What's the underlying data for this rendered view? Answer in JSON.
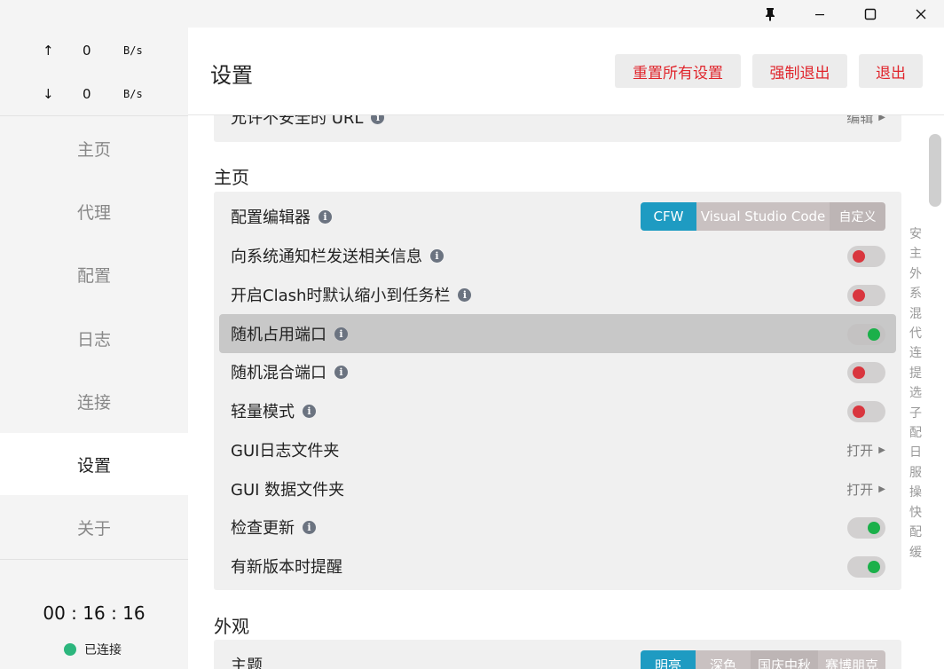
{
  "window": {
    "pin_icon": "pin-icon",
    "min_icon": "minimize-icon",
    "max_icon": "maximize-icon",
    "close_icon": "close-icon"
  },
  "traffic": {
    "up_arrow": "↑",
    "up_value": "0",
    "up_unit": "B/s",
    "down_arrow": "↓",
    "down_value": "0",
    "down_unit": "B/s"
  },
  "nav": {
    "home": "主页",
    "proxy": "代理",
    "profiles": "配置",
    "logs": "日志",
    "connections": "连接",
    "settings": "设置",
    "about": "关于"
  },
  "status": {
    "timer": "00 : 16 : 16",
    "connection": "已连接",
    "connection_color": "#2cb67d"
  },
  "header": {
    "title": "设置",
    "reset_all": "重置所有设置",
    "force_quit": "强制退出",
    "quit": "退出",
    "button_text_color": "#e0252c"
  },
  "prev_section": {
    "row_label": "允许不安全的 URL",
    "row_action": "编辑"
  },
  "home_section": {
    "title": "主页",
    "editor_label": "配置编辑器",
    "editor_options": [
      "CFW",
      "Visual Studio Code",
      "自定义"
    ],
    "editor_selected": "CFW",
    "notify_label": "向系统通知栏发送相关信息",
    "notify_on": false,
    "minimize_label": "开启Clash时默认缩小到任务栏",
    "minimize_on": false,
    "random_port_label": "随机占用端口",
    "random_port_on": true,
    "random_mixed_label": "随机混合端口",
    "random_mixed_on": false,
    "lite_label": "轻量模式",
    "lite_on": false,
    "gui_log_label": "GUI日志文件夹",
    "gui_log_action": "打开",
    "gui_data_label": "GUI 数据文件夹",
    "gui_data_action": "打开",
    "check_update_label": "检查更新",
    "check_update_on": true,
    "new_version_label": "有新版本时提醒",
    "new_version_on": true
  },
  "appearance_section": {
    "title": "外观",
    "theme_label": "主题",
    "theme_options": [
      "明亮",
      "深色",
      "国庆中秋",
      "赛博朋克"
    ],
    "theme_selected": "明亮"
  },
  "section_index": [
    "安",
    "主",
    "外",
    "系",
    "混",
    "代",
    "连",
    "提",
    "选",
    "子",
    "配",
    "日",
    "服",
    "操",
    "快",
    "配",
    "缓"
  ],
  "colors": {
    "accent": "#1e9bc2",
    "toggle_on": "#1bb04a",
    "toggle_off": "#d9363e"
  }
}
